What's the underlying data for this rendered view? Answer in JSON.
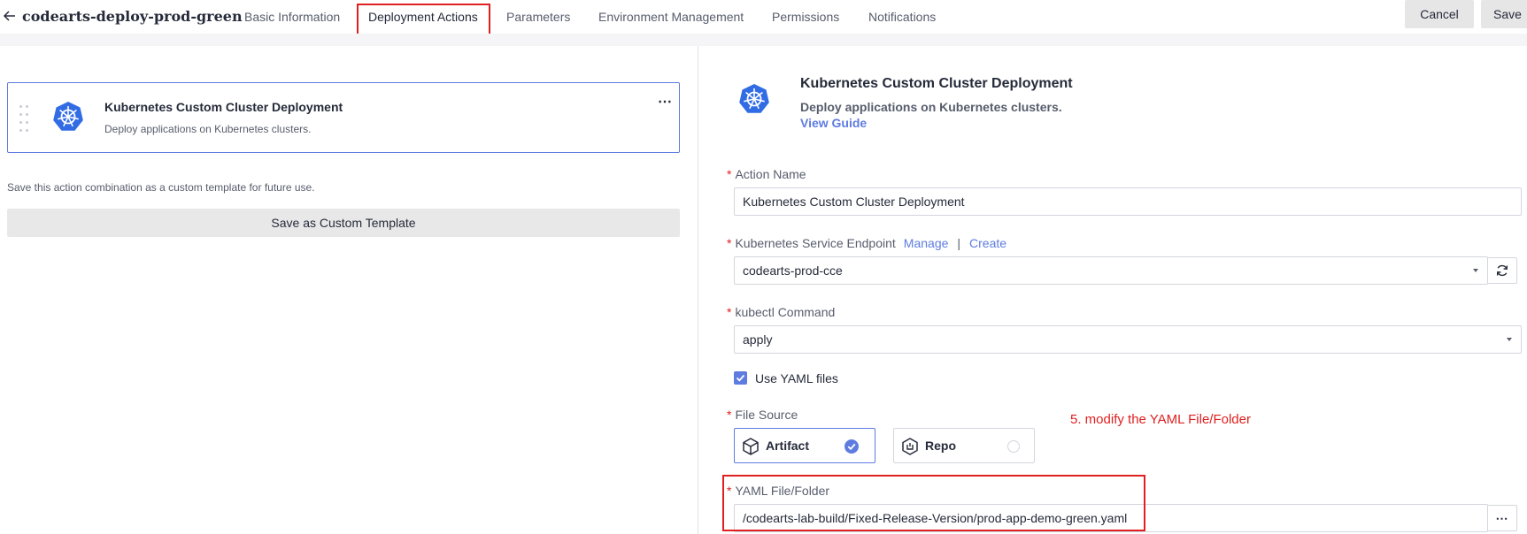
{
  "header": {
    "title": "codearts-deploy-prod-green",
    "tabs": [
      {
        "label": "Basic Information"
      },
      {
        "label": "Deployment Actions"
      },
      {
        "label": "Parameters"
      },
      {
        "label": "Environment Management"
      },
      {
        "label": "Permissions"
      },
      {
        "label": "Notifications"
      }
    ],
    "active_tab": "Deployment Actions",
    "cancel_label": "Cancel",
    "save_label": "Save"
  },
  "left_panel": {
    "action_card": {
      "title": "Kubernetes Custom Cluster Deployment",
      "description": "Deploy applications on Kubernetes clusters.",
      "icon": "kubernetes-icon"
    },
    "template_note": "Save this action combination as a custom template for future use.",
    "template_button": "Save as Custom Template"
  },
  "right_panel": {
    "title": "Kubernetes Custom Cluster Deployment",
    "description": "Deploy applications on Kubernetes clusters.",
    "guide_link": "View Guide",
    "action_name": {
      "label": "Action Name",
      "value": "Kubernetes Custom Cluster Deployment"
    },
    "endpoint": {
      "label": "Kubernetes Service Endpoint",
      "manage_link": "Manage",
      "separator": "|",
      "create_link": "Create",
      "value": "codearts-prod-cce"
    },
    "kubectl": {
      "label": "kubectl Command",
      "value": "apply"
    },
    "use_yaml": {
      "label": "Use YAML files",
      "checked": true
    },
    "file_source": {
      "label": "File Source",
      "options": [
        {
          "label": "Artifact",
          "selected": true
        },
        {
          "label": "Repo",
          "selected": false
        }
      ]
    },
    "yaml_path": {
      "label": "YAML File/Folder",
      "value": "/codearts-lab-build/Fixed-Release-Version/prod-app-demo-green.yaml"
    }
  },
  "annotation": "5. modify the YAML File/Folder",
  "colors": {
    "accent": "#5e7ce0",
    "annotation_red": "#e02020",
    "kubernetes_blue": "#326ce5"
  }
}
